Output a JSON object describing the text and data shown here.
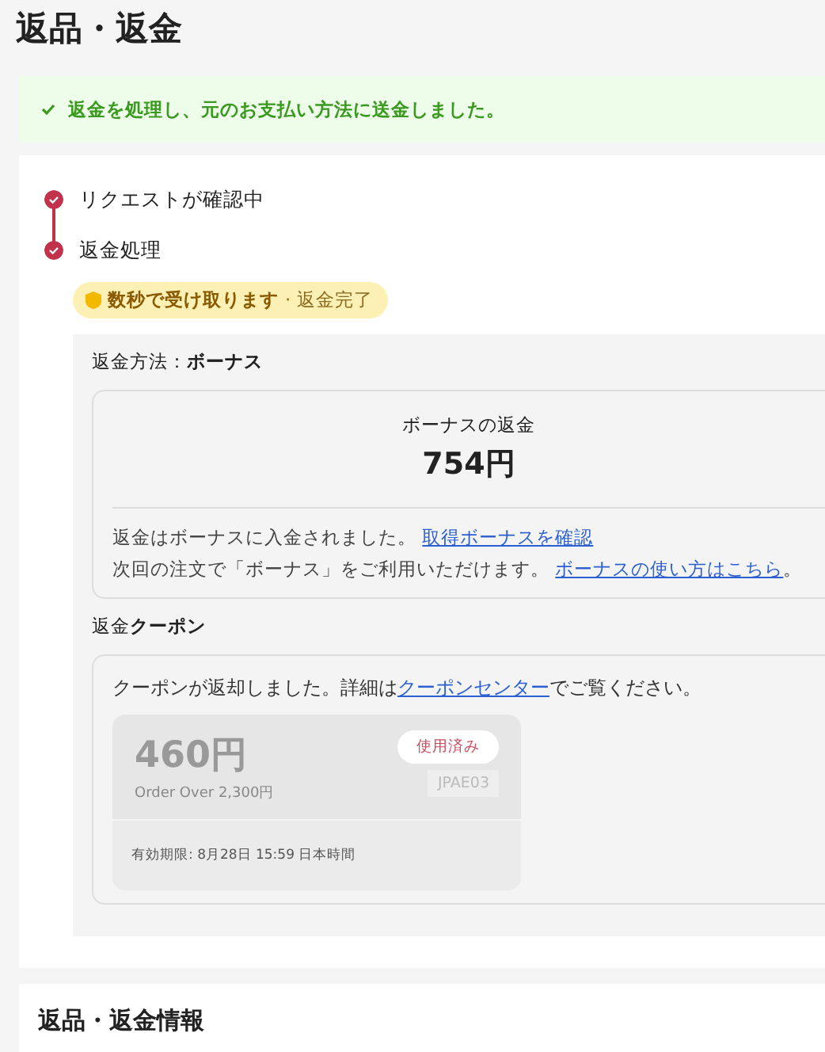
{
  "page_title": "返品・返金",
  "banner": {
    "message": "返金を処理し、元のお支払い方法に送金しました。"
  },
  "steps": [
    {
      "label": "リクエストが確認中",
      "done": true
    },
    {
      "label": "返金処理",
      "done": true
    }
  ],
  "status_badge": {
    "headline": "数秒で受け取ります",
    "note": "· 返金完了"
  },
  "refund_method": {
    "label": "返金方法：**ボーナス**",
    "amount_title": "ボーナスの返金",
    "amount": "754円",
    "lines": [
      {
        "text": "返金はボーナスに入金されました。",
        "link": "取得ボーナスを確認"
      },
      {
        "text": "次回の注文で「ボーナス」をご利用いただけます。",
        "link": "ボーナスの使い方はこちら",
        "after": "。"
      }
    ]
  },
  "refund_coupon": {
    "label": "返金**クーポン**",
    "message_before": "クーポンが返却しました。詳細は",
    "link": "クーポンセンター",
    "message_after": "でご覧ください。",
    "coupon": {
      "amount": "460円",
      "condition": "Order Over 2,300円",
      "status": "使用済み",
      "used": true,
      "code": "JPAE03",
      "expiry": "有効期限: 8月28日 15:59 日本時間"
    }
  },
  "info_title": "返品・返金情報"
}
